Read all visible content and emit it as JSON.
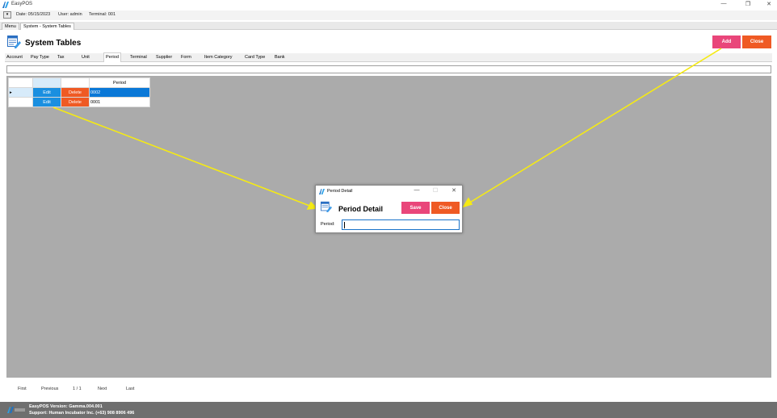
{
  "window": {
    "title": "EasyPOS",
    "minimize": "—",
    "maximize": "❐",
    "close": "✕"
  },
  "infobar": {
    "toggle": "▾",
    "date": "Date: 05/15/2023",
    "user": "User: admin",
    "terminal": "Terminal: 001"
  },
  "doc_tabs": [
    "Menu",
    "System - System Tables"
  ],
  "header": {
    "title": "System Tables",
    "add_label": "Add",
    "close_label": "Close"
  },
  "tabs": [
    "Account",
    "Pay Type",
    "Tax",
    "Unit",
    "Period",
    "Terminal",
    "Supplier",
    "Form",
    "Item Category",
    "Card Type",
    "Bank"
  ],
  "active_tab": "Period",
  "grid": {
    "column_header": "Period",
    "rows": [
      {
        "marker": "▸",
        "edit": "Edit",
        "delete": "Delete",
        "period": "0002"
      },
      {
        "marker": "",
        "edit": "Edit",
        "delete": "Delete",
        "period": "0001"
      }
    ]
  },
  "pager": {
    "first": "First",
    "previous": "Previous",
    "page": "1 / 1",
    "next": "Next",
    "last": "Last"
  },
  "status": {
    "version": "EasyPOS Version: Gamma.004.001",
    "support": "Support: Human Incubator Inc. (+63) 908 8906 496"
  },
  "dialog": {
    "title": "Period Detail",
    "heading": "Period Detail",
    "save_label": "Save",
    "close_label": "Close",
    "field_label": "Period:",
    "field_value": "",
    "minimize": "—",
    "maximize": "☐",
    "close": "✕"
  },
  "colors": {
    "accent_pink": "#e9467a",
    "accent_orange": "#ef5a24",
    "edit_blue": "#1a8fe0",
    "selection_blue": "#0a78d7",
    "arrow_yellow": "#f5ea14"
  }
}
